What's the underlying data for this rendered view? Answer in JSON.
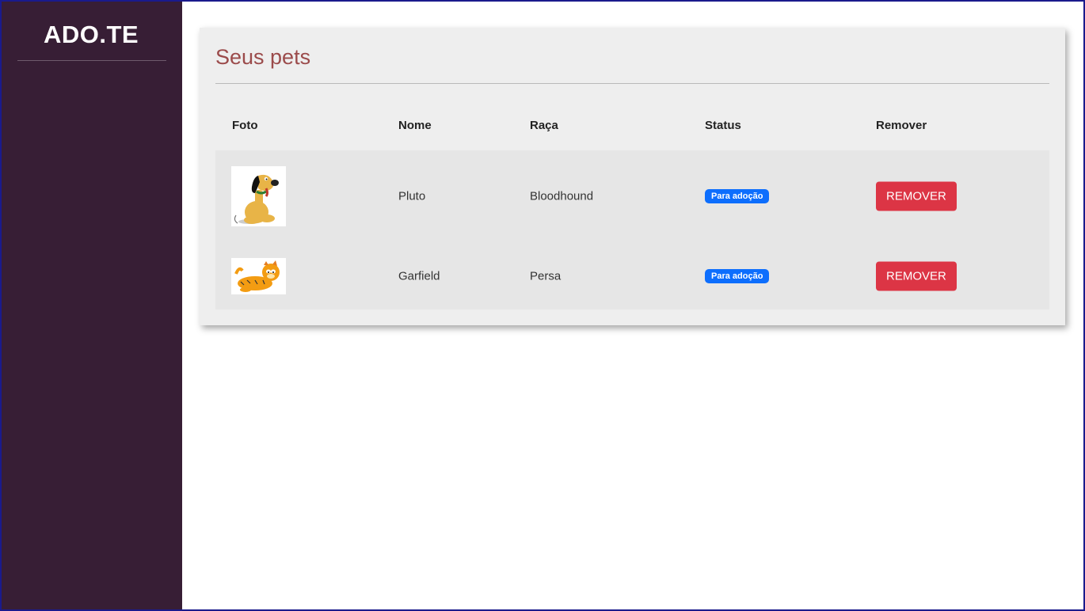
{
  "app": {
    "brand": "ADO.TE"
  },
  "page": {
    "title": "Seus pets"
  },
  "table": {
    "headers": [
      "Foto",
      "Nome",
      "Raça",
      "Status",
      "Remover"
    ],
    "rows": [
      {
        "photo_alt": "Pluto",
        "name": "Pluto",
        "breed": "Bloodhound",
        "status": "Para adoção",
        "action": "REMOVER"
      },
      {
        "photo_alt": "Garfield",
        "name": "Garfield",
        "breed": "Persa",
        "status": "Para adoção",
        "action": "REMOVER"
      }
    ]
  },
  "colors": {
    "sidebar": "#371e35",
    "title": "#9b4b4b",
    "badge": "#0d6efd",
    "danger": "#dc3545"
  }
}
